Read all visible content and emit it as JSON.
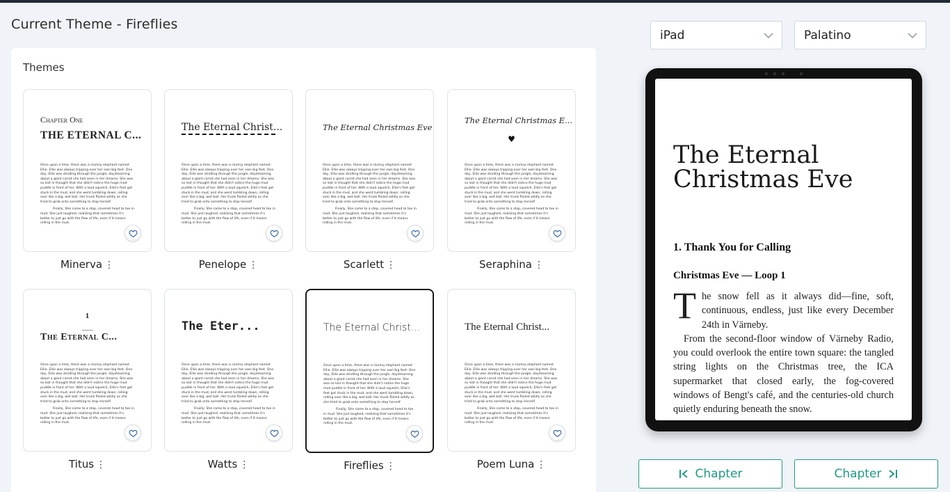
{
  "page": {
    "title": "Current Theme - Fireflies"
  },
  "themes": {
    "label": "Themes",
    "sample_text": {
      "p1": "Once upon a time, there was a clumsy elephant named Ellie. Ellie was always tripping over her own big feet. One day, Ellie was strolling through the jungle, daydreaming about a giant carrot she had seen in her dreams. She was so lost in thought that she didn't notice the huge mud puddle in front of her. With a loud squelch, Ellie's feet got stuck in the mud, and she went tumbling down, rolling over like a big, wet ball. Her trunk flailed wildly as she tried to grab onto something to stop herself.",
      "p2": "Finally, She came to a stop, covered head to toe in mud. She just laughed, realizing that sometimes it's better to just go with the flow of life, even if it means rolling in the mud."
    },
    "cards": [
      {
        "name": "Minerva",
        "chapter_label": "Chapter One",
        "heading": "THE ETERNAL C..."
      },
      {
        "name": "Penelope",
        "heading": "The Eternal Christ..."
      },
      {
        "name": "Scarlett",
        "heading": "The Eternal Christmas Eve"
      },
      {
        "name": "Seraphina",
        "heading": "The Eternal Christmas E..."
      },
      {
        "name": "Titus",
        "chapter_number": "1",
        "heading": "The Eternal C..."
      },
      {
        "name": "Watts",
        "heading": "The Eter..."
      },
      {
        "name": "Fireflies",
        "heading": "The Eternal Christ..."
      },
      {
        "name": "Poem Luna",
        "heading": "The Eternal Christ..."
      }
    ],
    "selected": "Fireflies"
  },
  "controls": {
    "device_select": "iPad",
    "font_select": "Palatino"
  },
  "preview": {
    "book_title": "The Eternal Christmas Eve",
    "chapter_heading": "1. Thank You for Calling",
    "subheading": "Christmas Eve — Loop 1",
    "drop_cap": "T",
    "para1_rest": "he snow fell as it always did—fine, soft, continuous, endless, just like every December 24th in Värneby.",
    "para2": "From the second-floor window of Värneby Radio, you could overlook the entire town square: the tangled string lights on the Christmas tree, the ICA supermarket that closed early, the fog-covered windows of Bengt's café, and the centuries-old church quietly enduring beneath the snow."
  },
  "navigation": {
    "prev_label": "Chapter",
    "next_label": "Chapter"
  },
  "colors": {
    "accent": "#1e9a86",
    "heart": "#2f5fa8"
  }
}
